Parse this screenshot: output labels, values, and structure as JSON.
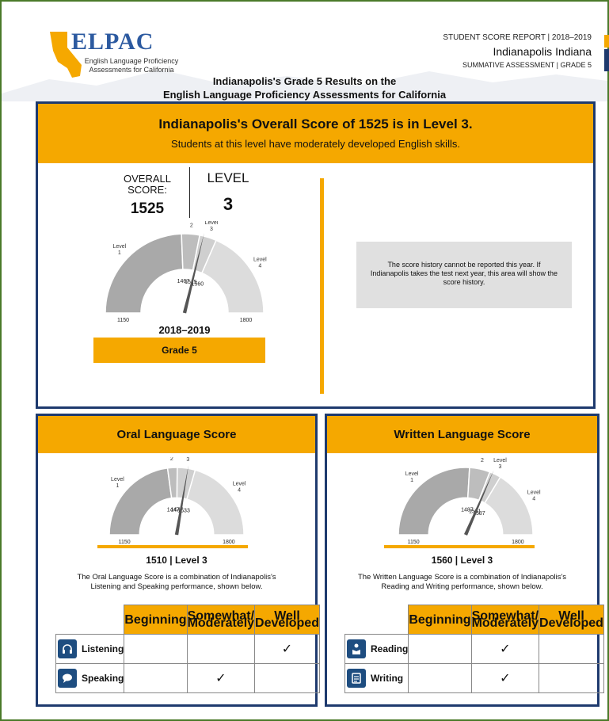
{
  "header": {
    "logo": {
      "title": "ELPAC",
      "subtitle_1": "English Language Proficiency",
      "subtitle_2": "Assessments for California"
    },
    "report_line": "STUDENT SCORE REPORT | 2018–2019",
    "location": "Indianapolis Indiana",
    "assessment_line": "SUMMATIVE ASSESSMENT | GRADE 5",
    "title_1": "Indianapolis's Grade 5 Results on the",
    "title_2": "English Language Proficiency Assessments for California"
  },
  "overall": {
    "headline": "Indianapolis's Overall Score of 1525 is in Level 3.",
    "subline": "Students at this level have moderately developed English skills.",
    "score_label_1": "OVERALL",
    "score_label_2": "SCORE:",
    "score": "1525",
    "level_label": "LEVEL",
    "level": "3",
    "year": "2018–2019",
    "grade": "Grade 5",
    "history_note": "The score history cannot be reported this year. If Indianapolis takes the test next year, this area will show the score history.",
    "gauge": {
      "min": 1150,
      "max": 1800,
      "value": 1525,
      "cuts": [
        1467,
        1515,
        1560
      ],
      "cut_labels": [
        "1467",
        "1515",
        "1560"
      ],
      "min_label": "1150",
      "max_label": "1800",
      "level_labels": [
        [
          "Level",
          "1"
        ],
        [
          "Level",
          "2"
        ],
        [
          "Level",
          "3"
        ],
        [
          "Level",
          "4"
        ]
      ]
    }
  },
  "oral": {
    "title": "Oral Language Score",
    "score_line": "1510 |  Level 3",
    "description_1": "The Oral Language Score is a combination of Indianapolis's",
    "description_2": "Listening and Speaking performance, shown below.",
    "gauge": {
      "min": 1150,
      "max": 1800,
      "value": 1510,
      "cuts": [
        1447,
        1477,
        1533
      ],
      "cut_labels": [
        "1447",
        "1477",
        "1533"
      ],
      "min_label": "1150",
      "max_label": "1800",
      "level_labels": [
        [
          "Level",
          "1"
        ],
        [
          "Level",
          "2"
        ],
        [
          "Level",
          "3"
        ],
        [
          "Level",
          "4"
        ]
      ]
    },
    "table": {
      "headers": [
        "Beginning",
        "Somewhat/\nModerately",
        "Well\nDeveloped"
      ],
      "rows": [
        {
          "label": "Listening",
          "icon": "headphones-icon",
          "check": 2
        },
        {
          "label": "Speaking",
          "icon": "speech-bubble-icon",
          "check": 1
        }
      ]
    }
  },
  "written": {
    "title": "Written Language Score",
    "score_line": "1560 |  Level 3",
    "description_1": "The Written Language Score is a combination of Indianapolis's",
    "description_2": "Reading and Writing performance, shown below.",
    "gauge": {
      "min": 1150,
      "max": 1800,
      "value": 1560,
      "cuts": [
        1487,
        1551,
        1587
      ],
      "cut_labels": [
        "1487",
        "1551",
        "1587"
      ],
      "min_label": "1150",
      "max_label": "1800",
      "level_labels": [
        [
          "Level",
          "1"
        ],
        [
          "Level",
          "2"
        ],
        [
          "Level",
          "3"
        ],
        [
          "Level",
          "4"
        ]
      ]
    },
    "table": {
      "headers": [
        "Beginning",
        "Somewhat/\nModerately",
        "Well\nDeveloped"
      ],
      "rows": [
        {
          "label": "Reading",
          "icon": "reader-icon",
          "check": 1
        },
        {
          "label": "Writing",
          "icon": "document-icon",
          "check": 1
        }
      ]
    }
  },
  "check_mark": "✓",
  "colors": {
    "accent": "#f5a800",
    "navy": "#1e3a6e",
    "gauge_dark": "#a9a9a9",
    "gauge_light": "#d6d6d6"
  }
}
